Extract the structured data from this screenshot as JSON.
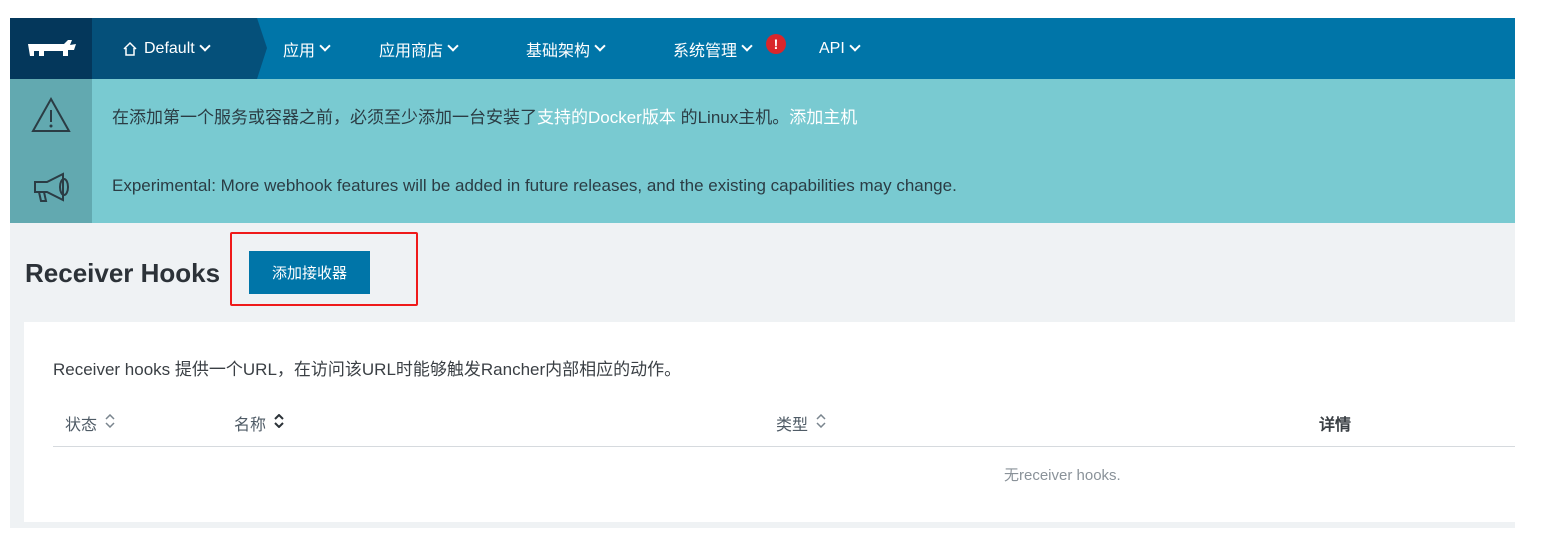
{
  "nav": {
    "logo_icon": "rancher-logo-icon",
    "environment": {
      "icon": "home-icon",
      "label": "Default"
    },
    "items": [
      {
        "label": "应用"
      },
      {
        "label": "应用商店"
      },
      {
        "label": "基础架构"
      },
      {
        "label": "系统管理",
        "alert": "!"
      },
      {
        "label": "API"
      }
    ]
  },
  "banners": {
    "warning": {
      "icon": "warning-icon",
      "text_before": "在添加第一个服务或容器之前，必须至少添加一台安装了",
      "link_docker": "支持的Docker版本",
      "text_after": " 的Linux主机。",
      "link_add_host": "添加主机"
    },
    "experimental": {
      "icon": "megaphone-icon",
      "text": "Experimental: More webhook features will be added in future releases, and the existing capabilities may change."
    }
  },
  "page": {
    "title": "Receiver Hooks",
    "add_button": "添加接收器"
  },
  "content": {
    "description": "Receiver hooks 提供一个URL，在访问该URL时能够触发Rancher内部相应的动作。",
    "columns": [
      {
        "label": "状态",
        "sortable": true
      },
      {
        "label": "名称",
        "sortable": true
      },
      {
        "label": "类型",
        "sortable": true
      },
      {
        "label": "详情",
        "sortable": false
      }
    ],
    "empty_message": "无receiver hooks."
  },
  "colors": {
    "nav_bg": "#0075a8",
    "nav_dark": "#04375b",
    "banner_bg": "#79cad1",
    "highlight": "#ef1a1a"
  }
}
